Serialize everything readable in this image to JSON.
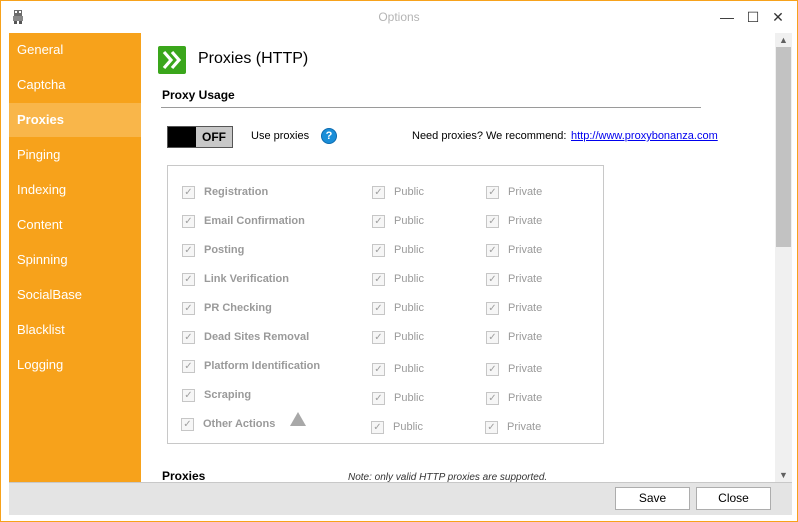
{
  "window": {
    "title": "Options",
    "border_color": "#f7a21b",
    "minimize_glyph": "—",
    "maximize_glyph": "☐",
    "close_glyph": "✕"
  },
  "sidebar": {
    "accent": "#f7a21b",
    "active_index": 2,
    "items": [
      {
        "label": "General"
      },
      {
        "label": "Captcha"
      },
      {
        "label": "Proxies"
      },
      {
        "label": "Pinging"
      },
      {
        "label": "Indexing"
      },
      {
        "label": "Content"
      },
      {
        "label": "Spinning"
      },
      {
        "label": "SocialBase"
      },
      {
        "label": "Blacklist"
      },
      {
        "label": "Logging"
      }
    ]
  },
  "page": {
    "title": "Proxies (HTTP)",
    "icon": "double-chevron-right-icon",
    "icon_color": "#3aa61b"
  },
  "proxy_usage": {
    "heading": "Proxy Usage",
    "toggle_label": "OFF",
    "use_proxies_label": "Use proxies",
    "help_glyph": "?",
    "recommend_text": "Need proxies? We recommend:",
    "recommend_link": "http://www.proxybonanza.com",
    "rows": [
      {
        "action": "Registration",
        "public": "Public",
        "private": "Private"
      },
      {
        "action": "Email Confirmation",
        "public": "Public",
        "private": "Private"
      },
      {
        "action": "Posting",
        "public": "Public",
        "private": "Private"
      },
      {
        "action": "Link Verification",
        "public": "Public",
        "private": "Private"
      },
      {
        "action": "PR Checking",
        "public": "Public",
        "private": "Private"
      },
      {
        "action": "Dead Sites Removal",
        "public": "Public",
        "private": "Private"
      },
      {
        "action": "Platform Identification",
        "public": "Public",
        "private": "Private"
      },
      {
        "action": "Scraping",
        "public": "Public",
        "private": "Private"
      },
      {
        "action": "Other Actions",
        "public": "Public",
        "private": "Private"
      }
    ],
    "check_glyph": "✓"
  },
  "proxies": {
    "heading": "Proxies",
    "note": "Note: only valid HTTP proxies are supported."
  },
  "footer": {
    "save_label": "Save",
    "close_label": "Close"
  }
}
